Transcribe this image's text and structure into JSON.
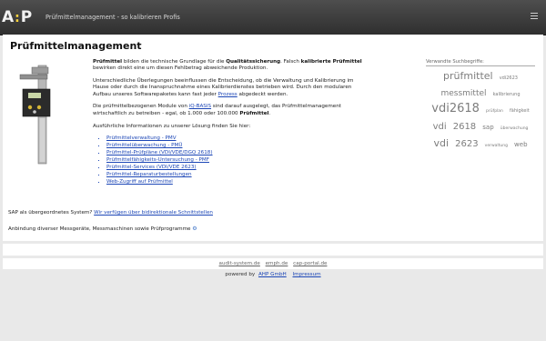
{
  "header": {
    "logo_left": "A",
    "logo_colon": ":",
    "logo_right": "P",
    "tagline": "Prüfmittelmanagement - so kalibrieren Profis",
    "menu_icon": "hamburger-icon"
  },
  "page": {
    "title": "Prüfmittelmanagement"
  },
  "content": {
    "p1": {
      "b1": "Prüfmittel",
      "t1": " bilden die technische Grundlage für die ",
      "b2": "Qualitätssicherung",
      "t2": ". Falsch ",
      "b3": "kalibrierte Prüfmittel",
      "t3": " bewirken direkt eine um diesen Fehlbetrag abweichende Produktion."
    },
    "p2": {
      "t1": "Unterschiedliche Überlegungen beeinflussen die Entscheidung, ob die Verwaltung und Kalibrierung im Hause oder durch die Inanspruchnahme eines Kalibrierdienstes betrieben wird. Durch den modularen Aufbau unseres Softwarepaketes kann fast jeder ",
      "link": "Prozess",
      "t2": " abgedeckt werden."
    },
    "p3": {
      "t1": "Die prüfmittelbezogenen Module von ",
      "link": "iQ-BASIS",
      "t2": " sind darauf ausgelegt, das Prüfmittelmanagement wirtschaftlich zu betreiben - egal, ob 1.000 oder 100.000 ",
      "b1": "Prüfmittel",
      "t3": "."
    },
    "p4": "Ausführliche Informationen zu unserer Lösung finden Sie hier:",
    "links": [
      "Prüfmittelverwaltung - PMV",
      "Prüfmittelüberwachung - PMÜ",
      "Prüfmittel-Prüfpläne (VDI/VDE/DGQ 2618)",
      "Prüfmittelfähigkeits-Untersuchung - PMF",
      "Prüfmittel-Services (VDI/VDE 2623)",
      "Prüfmittel-Reparaturbestellungen",
      "Web-Zugriff auf Prüfmittel"
    ],
    "sap": {
      "t1": "SAP als übergeordnetes System? ",
      "link": "Wir verfügen über bidirektionale Schnittstellen"
    },
    "devices": "Anbindung diverser Messgeräte, Messmaschinen sowie Prüfprogramme",
    "devices_icon": "gear-icon"
  },
  "tagcloud": {
    "title": "Verwandte Suchbegriffe:",
    "tags": [
      {
        "text": "prüfmittel",
        "size": 11
      },
      {
        "text": "vdi2623",
        "size": 5
      },
      {
        "text": "messmittel",
        "size": 9
      },
      {
        "text": "kalibrierung",
        "size": 5
      },
      {
        "text": "vdi2618",
        "size": 13
      },
      {
        "text": "prüfplan",
        "size": 4.5
      },
      {
        "text": "fähigkeit",
        "size": 5
      },
      {
        "text": "vdi",
        "size": 10
      },
      {
        "text": "2618",
        "size": 10
      },
      {
        "text": "sap",
        "size": 7
      },
      {
        "text": "überwachung",
        "size": 4.5
      },
      {
        "text": "vdi",
        "size": 11
      },
      {
        "text": "2623",
        "size": 10
      },
      {
        "text": "verwaltung",
        "size": 4.5
      },
      {
        "text": "web",
        "size": 7
      }
    ]
  },
  "footer": {
    "links": [
      "audit-system.de",
      "emph.de",
      "cap-portal.de"
    ],
    "powered_prefix": "powered by",
    "company": "AHP GmbH",
    "impressum": "Impressum"
  }
}
